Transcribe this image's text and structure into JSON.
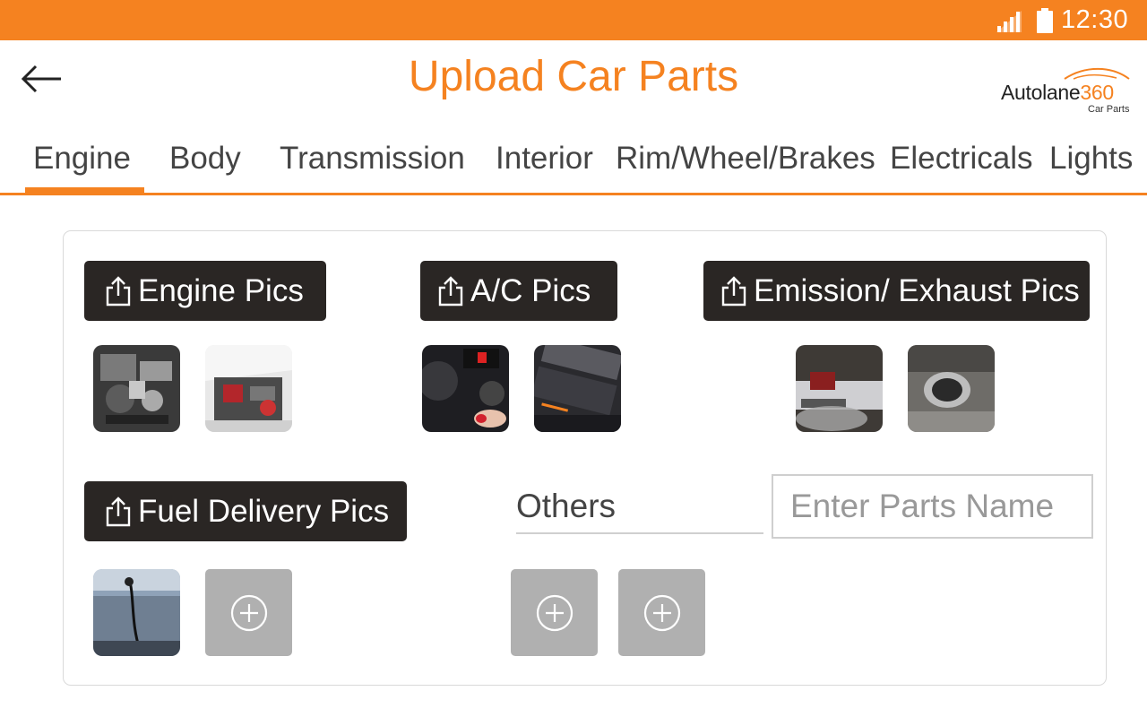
{
  "status_bar": {
    "time": "12:30",
    "color": "#f58220"
  },
  "header": {
    "title": "Upload Car Parts",
    "back_icon": "arrow-left-icon",
    "logo": {
      "brand": "Autolane",
      "brand_number": "360",
      "subtitle": "Car Parts"
    }
  },
  "tabs": [
    {
      "label": "Engine",
      "active": true
    },
    {
      "label": "Body"
    },
    {
      "label": "Transmission"
    },
    {
      "label": "Interior"
    },
    {
      "label": "Rim/Wheel/Brakes"
    },
    {
      "label": "Electricals"
    },
    {
      "label": "Lights"
    }
  ],
  "sections": {
    "engine": {
      "button_label": "Engine Pics",
      "icon": "share-upload-icon"
    },
    "ac": {
      "button_label": "A/C Pics",
      "icon": "share-upload-icon"
    },
    "emission": {
      "button_label": "Emission/ Exhaust Pics",
      "icon": "share-upload-icon"
    },
    "fuel": {
      "button_label": "Fuel Delivery Pics",
      "icon": "share-upload-icon"
    },
    "others": {
      "label": "Others",
      "input_placeholder": "Enter Parts Name",
      "input_value": ""
    }
  },
  "colors": {
    "accent": "#f58220",
    "button_bg": "#2a2624",
    "add_tile": "#b0b0b0"
  }
}
